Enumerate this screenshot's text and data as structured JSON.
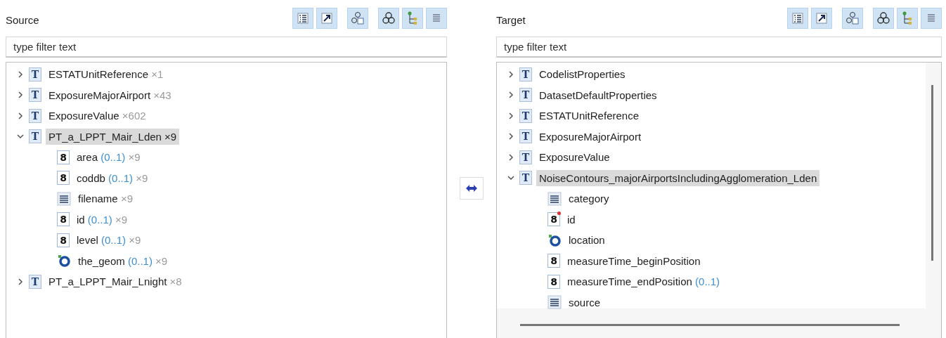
{
  "panels": [
    {
      "title": "Source",
      "filter": {
        "placeholder": "type filter text"
      },
      "toolbar": [
        {
          "kind": "list",
          "selected": true
        },
        {
          "kind": "arrow",
          "selected": true
        },
        {
          "kind": "group",
          "selected": true
        },
        {
          "kind": "circles",
          "selected": true
        },
        {
          "kind": "hierarchy",
          "selected": true
        },
        {
          "kind": "lines",
          "selected": true
        }
      ],
      "tree": [
        {
          "kind": "type",
          "glyph": "T",
          "name": "ESTATUnitReference",
          "count": "×1",
          "expanded": false,
          "selected": false
        },
        {
          "kind": "type",
          "glyph": "T",
          "name": "ExposureMajorAirport",
          "count": "×43",
          "expanded": false,
          "selected": false
        },
        {
          "kind": "type",
          "glyph": "T",
          "name": "ExposureValue",
          "count": "×602",
          "expanded": false,
          "selected": false
        },
        {
          "kind": "type",
          "glyph": "T",
          "name": "PT_a_LPPT_Mair_Lden",
          "count": "×9",
          "expanded": true,
          "selected": true,
          "children": [
            {
              "kind": "number",
              "glyph": "8",
              "name": "area",
              "cardinality": "(0..1)",
              "count": "×9",
              "selected": false
            },
            {
              "kind": "number",
              "glyph": "8",
              "name": "coddb",
              "cardinality": "(0..1)",
              "count": "×9",
              "selected": false
            },
            {
              "kind": "string",
              "name": "filename",
              "count": "×9",
              "selected": false
            },
            {
              "kind": "number",
              "glyph": "8",
              "name": "id",
              "cardinality": "(0..1)",
              "count": "×9",
              "selected": false
            },
            {
              "kind": "number",
              "glyph": "8",
              "name": "level",
              "cardinality": "(0..1)",
              "count": "×9",
              "selected": false
            },
            {
              "kind": "geometry",
              "name": "the_geom",
              "cardinality": "(0..1)",
              "count": "×9",
              "selected": false
            }
          ]
        },
        {
          "kind": "type",
          "glyph": "T",
          "name": "PT_a_LPPT_Mair_Lnight",
          "count": "×8",
          "expanded": false,
          "selected": false
        }
      ]
    },
    {
      "title": "Target",
      "filter": {
        "placeholder": "type filter text"
      },
      "toolbar": [
        {
          "kind": "list",
          "selected": true
        },
        {
          "kind": "arrow",
          "selected": true
        },
        {
          "kind": "group",
          "selected": true
        },
        {
          "kind": "circles",
          "selected": true
        },
        {
          "kind": "hierarchy",
          "selected": true
        },
        {
          "kind": "lines",
          "selected": true
        }
      ],
      "tree": [
        {
          "kind": "type",
          "glyph": "T",
          "name": "CodelistProperties",
          "expanded": false,
          "selected": false
        },
        {
          "kind": "type",
          "glyph": "T",
          "name": "DatasetDefaultProperties",
          "expanded": false,
          "selected": false
        },
        {
          "kind": "type",
          "glyph": "T",
          "name": "ESTATUnitReference",
          "expanded": false,
          "selected": false
        },
        {
          "kind": "type",
          "glyph": "T",
          "name": "ExposureMajorAirport",
          "expanded": false,
          "selected": false
        },
        {
          "kind": "type",
          "glyph": "T",
          "name": "ExposureValue",
          "expanded": false,
          "selected": false
        },
        {
          "kind": "type",
          "glyph": "T",
          "name": "NoiseContours_majorAirportsIncludingAgglomeration_Lden",
          "expanded": true,
          "selected": true,
          "children": [
            {
              "kind": "string",
              "name": "category",
              "selected": false
            },
            {
              "kind": "key",
              "glyph": "8",
              "name": "id",
              "selected": false
            },
            {
              "kind": "geometry",
              "name": "location",
              "selected": false
            },
            {
              "kind": "number",
              "glyph": "8",
              "name": "measureTime_beginPosition",
              "selected": false
            },
            {
              "kind": "number",
              "glyph": "8",
              "name": "measureTime_endPosition",
              "cardinality": "(0..1)",
              "selected": false
            },
            {
              "kind": "string",
              "name": "source",
              "selected": false
            }
          ]
        }
      ]
    }
  ]
}
